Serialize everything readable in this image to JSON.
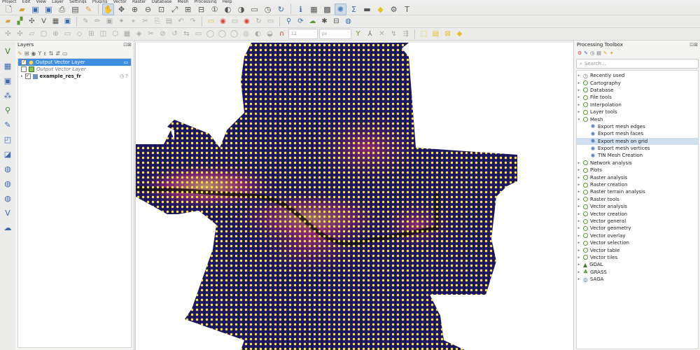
{
  "menu": [
    "Project",
    "Edit",
    "View",
    "Layer",
    "Settings",
    "Plugins",
    "Vector",
    "Raster",
    "Database",
    "Mesh",
    "Processing",
    "Help"
  ],
  "layers_panel": {
    "title": "Layers",
    "items": [
      {
        "label": "Output Vector Layer",
        "selected": true,
        "checked": true,
        "style": "normal"
      },
      {
        "label": "Output Vector Layer",
        "selected": false,
        "checked": false,
        "style": "italic"
      },
      {
        "label": "example_res_fr",
        "selected": false,
        "checked": true,
        "style": "bold"
      }
    ]
  },
  "toolbox": {
    "title": "Processing Toolbox",
    "search_placeholder": "Search...",
    "groups": [
      {
        "label": "Recently used",
        "icon": "clock-icon",
        "expanded": false
      },
      {
        "label": "Cartography",
        "icon": "qgis-icon",
        "expanded": false
      },
      {
        "label": "Database",
        "icon": "qgis-icon",
        "expanded": false
      },
      {
        "label": "File tools",
        "icon": "qgis-icon",
        "expanded": false
      },
      {
        "label": "Interpolation",
        "icon": "qgis-icon",
        "expanded": false
      },
      {
        "label": "Layer tools",
        "icon": "qgis-icon",
        "expanded": false
      },
      {
        "label": "Mesh",
        "icon": "qgis-icon",
        "expanded": true,
        "children": [
          {
            "label": "Export mesh edges",
            "highlighted": false
          },
          {
            "label": "Export mesh faces",
            "highlighted": false
          },
          {
            "label": "Export mesh on grid",
            "highlighted": true
          },
          {
            "label": "Export mesh vertices",
            "highlighted": false
          },
          {
            "label": "TIN Mesh Creation",
            "highlighted": false
          }
        ]
      },
      {
        "label": "Network analysis",
        "icon": "qgis-icon",
        "expanded": false
      },
      {
        "label": "Plots",
        "icon": "qgis-icon",
        "expanded": false
      },
      {
        "label": "Raster analysis",
        "icon": "qgis-icon",
        "expanded": false
      },
      {
        "label": "Raster creation",
        "icon": "qgis-icon",
        "expanded": false
      },
      {
        "label": "Raster terrain analysis",
        "icon": "qgis-icon",
        "expanded": false
      },
      {
        "label": "Raster tools",
        "icon": "qgis-icon",
        "expanded": false
      },
      {
        "label": "Vector analysis",
        "icon": "qgis-icon",
        "expanded": false
      },
      {
        "label": "Vector creation",
        "icon": "qgis-icon",
        "expanded": false
      },
      {
        "label": "Vector general",
        "icon": "qgis-icon",
        "expanded": false
      },
      {
        "label": "Vector geometry",
        "icon": "qgis-icon",
        "expanded": false
      },
      {
        "label": "Vector overlay",
        "icon": "qgis-icon",
        "expanded": false
      },
      {
        "label": "Vector selection",
        "icon": "qgis-icon",
        "expanded": false
      },
      {
        "label": "Vector table",
        "icon": "qgis-icon",
        "expanded": false
      },
      {
        "label": "Vector tiles",
        "icon": "qgis-icon",
        "expanded": false
      },
      {
        "label": "GDAL",
        "icon": "gdal-icon",
        "expanded": false
      },
      {
        "label": "GRASS",
        "icon": "grass-icon",
        "expanded": false
      },
      {
        "label": "SAGA",
        "icon": "saga-icon",
        "expanded": false
      }
    ]
  },
  "toolbar": {
    "font_size": "12",
    "unit": "px"
  },
  "colors": {
    "mesh_background": "#1a1660",
    "grid_point": "#ffe24a",
    "selection": "#3d8ee0"
  }
}
